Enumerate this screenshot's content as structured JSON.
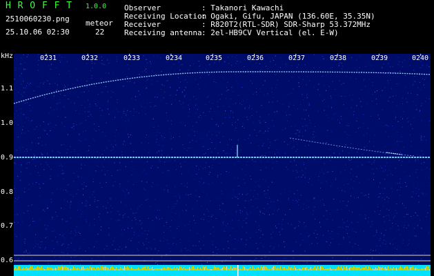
{
  "header": {
    "app_title": "H R O F F T",
    "version": "1.0.0",
    "filename": "2510060230.png",
    "datetime": "25.10.06 02:30",
    "meteor_label": "meteor",
    "meteor_count": "22",
    "info": [
      {
        "label": "Observer",
        "value": ": Takanori Kawachi"
      },
      {
        "label": "Receiving Location",
        "value": ": Ogaki, Gifu, JAPAN (136.60E, 35.35N)"
      },
      {
        "label": "Receiver",
        "value": ": R820T2(RTL-SDR) SDR-Sharp 53.372MHz"
      },
      {
        "label": "Receiving antenna",
        "value": ": 2el-HB9CV Vertical (el. E-W)"
      }
    ]
  },
  "spectrogram": {
    "unit_label": "kHz",
    "y_ticks": [
      "1.1",
      "1.0",
      "0.9",
      "0.8",
      "0.7",
      "0.6"
    ],
    "time_ticks": [
      "0231",
      "0232",
      "0233",
      "0234",
      "0235",
      "0236",
      "0237",
      "0238",
      "0239",
      "0240"
    ],
    "colors": {
      "background": "#000c6a",
      "noise": "#3050ff",
      "trace": "#9fdcff",
      "carrier": "#7ad0ff",
      "marker_line": "#e8d8a0",
      "strip": "#00e0ff",
      "header_green": "#3cff3c"
    }
  }
}
